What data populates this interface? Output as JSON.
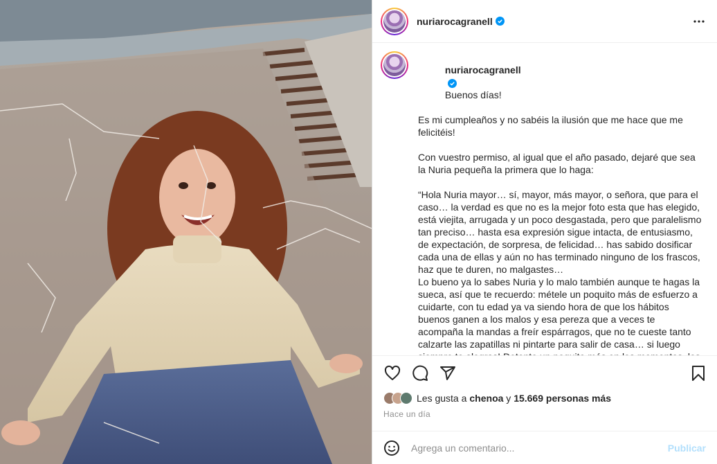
{
  "post": {
    "username": "nuriarocagranell",
    "verified_icon": "verified-badge-icon",
    "more_icon": "more-options-icon"
  },
  "caption": {
    "username": "nuriarocagranell",
    "first_line": "Buenos días!",
    "paragraphs": [
      "Es mi cumpleaños y no sabéis la ilusión que me hace que me felicitéis!",
      "Con vuestro permiso, al igual que el año pasado, dejaré que sea la Nuria pequeña la primera que lo haga:",
      "“Hola Nuria mayor… sí, mayor, más mayor, o señora, que para el caso… la verdad es que no es la mejor foto esta que has elegido, está viejita, arrugada y un poco desgastada, pero que paralelismo tan preciso… hasta esa expresión sigue intacta, de entusiasmo, de expectación, de sorpresa, de felicidad… has sabido dosificar cada una de ellas y aún no has terminado ninguno de los frascos, haz que te duren, no malgastes…\nLo bueno ya lo sabes Nuria y lo malo también aunque te hagas la sueca, así que te recuerdo: mételE un poquito más de esfuerzo a cuidarte, con tu edad ya va siendo hora de que los hábitos buenos ganen a los malos y esa pereza que a veces te acompaña la mandas a freír espárragos, que no te cueste tanto calzarte las zapatillas ni pintarte para salir de casa… si luego siempre te alegras! Detente un poquito más en los momentos, los buenos los saborearás mejor y los malos igual hasta llegas a comprenderlos, no por ir más rápido o pasar por encima te tocan menos o se olvidan…"
    ]
  },
  "actions": {
    "like_icon": "heart-icon",
    "comment_icon": "comment-icon",
    "share_icon": "share-icon",
    "save_icon": "bookmark-icon"
  },
  "likes": {
    "prefix": "Les gusta a ",
    "user": "chenoa",
    "middle": " y ",
    "count": "15.669 personas más"
  },
  "time_ago": "Hace un día",
  "comment": {
    "placeholder": "Agrega un comentario...",
    "publish_label": "Publicar",
    "emoji_icon": "emoji-icon"
  }
}
